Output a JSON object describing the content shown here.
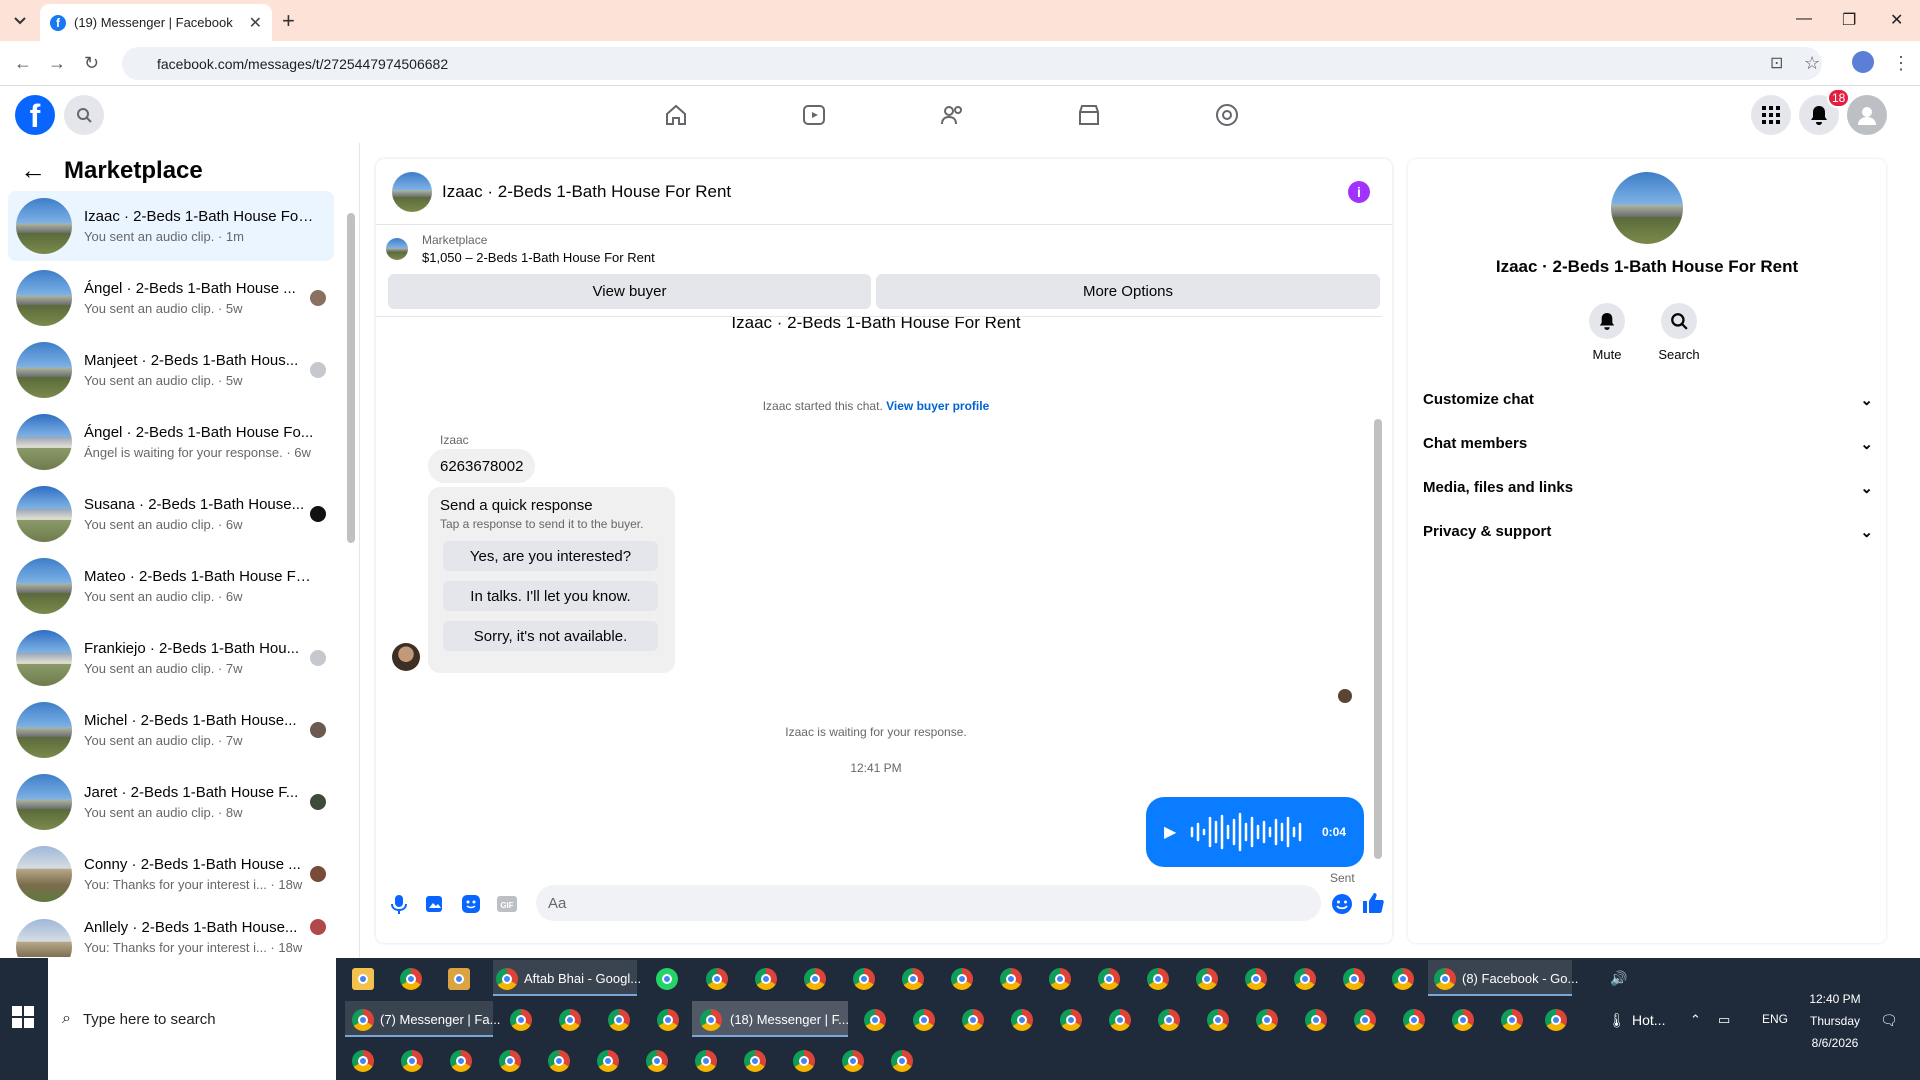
{
  "browser": {
    "tab_title": "(19) Messenger | Facebook",
    "url": "facebook.com/messages/t/2725447974506682"
  },
  "header": {
    "notifications_count": "18"
  },
  "sidebar": {
    "title": "Marketplace",
    "conversations": [
      {
        "name": "Izaac · 2-Beds 1-Bath House For ...",
        "sub": "You sent an audio clip. · 1m"
      },
      {
        "name": "Ángel · 2-Beds 1-Bath House ...",
        "sub": "You sent an audio clip. · 5w"
      },
      {
        "name": "Manjeet · 2-Beds 1-Bath Hous...",
        "sub": "You sent an audio clip. · 5w"
      },
      {
        "name": "Ángel · 2-Beds 1-Bath House Fo...",
        "sub": "Ángel is waiting for your response. · 6w"
      },
      {
        "name": "Susana · 2-Beds 1-Bath House...",
        "sub": "You sent an audio clip. · 6w"
      },
      {
        "name": "Mateo · 2-Beds 1-Bath House Fo...",
        "sub": "You sent an audio clip. · 6w"
      },
      {
        "name": "Frankiejo · 2-Beds 1-Bath Hou...",
        "sub": "You sent an audio clip. · 7w"
      },
      {
        "name": "Michel · 2-Beds 1-Bath House...",
        "sub": "You sent an audio clip. · 7w"
      },
      {
        "name": "Jaret · 2-Beds 1-Bath House F...",
        "sub": "You sent an audio clip. · 8w"
      },
      {
        "name": "Conny · 2-Beds 1-Bath House ...",
        "sub": "You: Thanks for your interest i... · 18w"
      },
      {
        "name": "Anllely · 2-Beds 1-Bath House...",
        "sub": "You: Thanks for your interest i... · 18w"
      }
    ]
  },
  "chat": {
    "title": "Izaac · 2-Beds 1-Bath House For Rent",
    "marketplace_label": "Marketplace",
    "listing": "$1,050 – 2-Beds 1-Bath House For Rent",
    "view_buyer": "View buyer",
    "more_options": "More Options",
    "top_title": "Izaac · 2-Beds 1-Bath House For Rent",
    "started_text": "Izaac started this chat.",
    "view_buyer_profile": "View buyer profile",
    "sender_name": "Izaac",
    "phone": "6263678002",
    "quick_title": "Send a quick response",
    "quick_sub": "Tap a response to send it to the buyer.",
    "quick_options": [
      "Yes, are you interested?",
      "In talks. I'll let you know.",
      "Sorry, it's not available."
    ],
    "waiting_text": "Izaac is waiting for your response.",
    "time": "12:41 PM",
    "audio_duration": "0:04",
    "sent_label": "Sent",
    "input_placeholder": "Aa"
  },
  "details": {
    "title": "Izaac · 2-Beds 1-Bath House For Rent",
    "mute": "Mute",
    "search": "Search",
    "sections": [
      "Customize chat",
      "Chat members",
      "Media, files and links",
      "Privacy & support"
    ]
  },
  "taskbar": {
    "search_placeholder": "Type here to search",
    "row1_labels": [
      "Aftab Bhai - Googl...",
      "(8) Facebook - Go..."
    ],
    "row2_labels": [
      "(7) Messenger | Fa...",
      "(18) Messenger | F..."
    ],
    "weather": "Hot...",
    "lang": "ENG",
    "time": "12:40 PM",
    "day": "Thursday",
    "date": "8/6/2026"
  }
}
